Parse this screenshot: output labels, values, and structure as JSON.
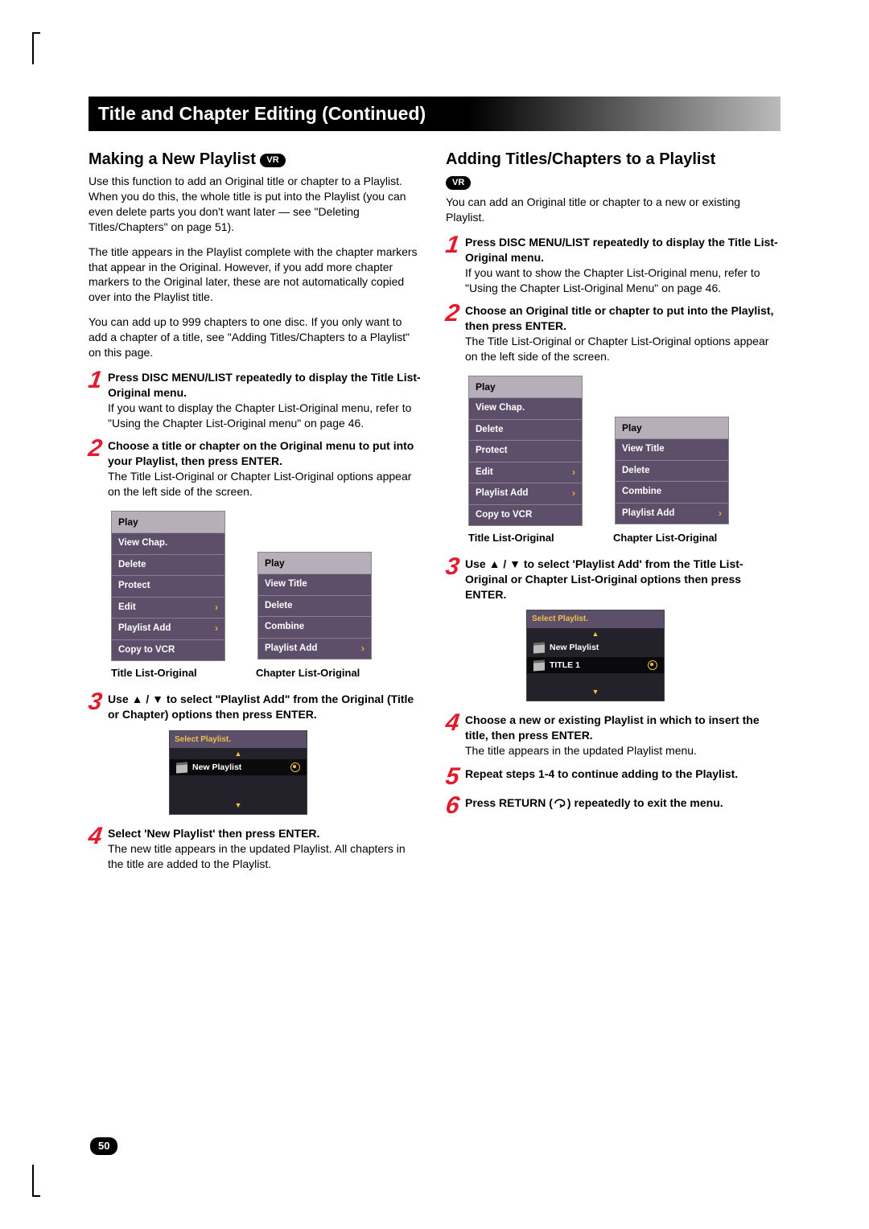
{
  "page_number": "50",
  "title_bar": "Title and Chapter Editing (Continued)",
  "vr_badge": "VR",
  "left": {
    "heading": "Making a New Playlist",
    "intro1": "Use this function to add an Original title or chapter to a Playlist. When you do this, the whole title is put into the Playlist (you can even delete parts you don't want later — see \"Deleting Titles/Chapters\" on page 51).",
    "intro2": "The title appears in the Playlist complete with the chapter markers that appear in the Original. However, if you add more chapter markers to the Original later, these are not automatically copied over into the Playlist title.",
    "intro3": "You can add up to 999 chapters to one disc. If you only want to add a chapter of a title, see \"Adding Titles/Chapters to a Playlist\" on this page.",
    "step1_bold": "Press DISC MENU/LIST repeatedly to display the Title List-Original menu.",
    "step1_rest": "If you want to display the Chapter List-Original menu, refer to \"Using the Chapter List-Original menu\" on page 46.",
    "step2_bold": "Choose a title or chapter on the Original menu to put into your Playlist, then press ENTER.",
    "step2_rest": "The Title List-Original or Chapter List-Original options appear on the left side of the screen.",
    "menu_title_hdr": "Play",
    "menu_title_rows": [
      "View Chap.",
      "Delete",
      "Protect",
      "Edit",
      "Playlist Add",
      "Copy to VCR"
    ],
    "menu_chapter_hdr": "Play",
    "menu_chapter_rows": [
      "View Title",
      "Delete",
      "Combine",
      "Playlist Add"
    ],
    "caption_title": "Title List-Original",
    "caption_chapter": "Chapter List-Original",
    "step3_bold": "Use ▲ / ▼ to select \"Playlist Add\" from the Original (Title or Chapter) options then press ENTER.",
    "popup_title": "Select Playlist.",
    "popup_new": "New Playlist",
    "step4_bold": "Select 'New Playlist' then press ENTER.",
    "step4_rest": "The new title appears in the updated Playlist. All chapters in the title are added to the Playlist."
  },
  "right": {
    "heading": "Adding Titles/Chapters to a Playlist",
    "intro": "You can add an Original title or chapter to a new or existing Playlist.",
    "step1_bold": "Press DISC MENU/LIST repeatedly to display the Title List-Original menu.",
    "step1_rest": "If you want to show the Chapter List-Original menu, refer to \"Using the Chapter List-Original Menu\" on page 46.",
    "step2_bold": "Choose an Original title or chapter to put into the Playlist, then press ENTER.",
    "step2_rest": "The Title List-Original or Chapter List-Original options appear on the left side of the screen.",
    "menu_title_hdr": "Play",
    "menu_title_rows": [
      "View Chap.",
      "Delete",
      "Protect",
      "Edit",
      "Playlist Add",
      "Copy to VCR"
    ],
    "menu_chapter_hdr": "Play",
    "menu_chapter_rows": [
      "View Title",
      "Delete",
      "Combine",
      "Playlist Add"
    ],
    "caption_title": "Title List-Original",
    "caption_chapter": "Chapter List-Original",
    "step3_bold": "Use ▲ / ▼ to select 'Playlist Add' from the Title List-Original or Chapter List-Original options then press ENTER.",
    "popup_title": "Select Playlist.",
    "popup_new": "New Playlist",
    "popup_title1": "TITLE 1",
    "step4_bold": "Choose a new or existing Playlist in which to insert the title, then press ENTER.",
    "step4_rest": "The title appears in the updated Playlist menu.",
    "step5_bold": "Repeat steps 1-4 to continue adding to the Playlist.",
    "step6_bold_a": "Press RETURN (",
    "step6_bold_b": ") repeatedly to exit the menu."
  }
}
